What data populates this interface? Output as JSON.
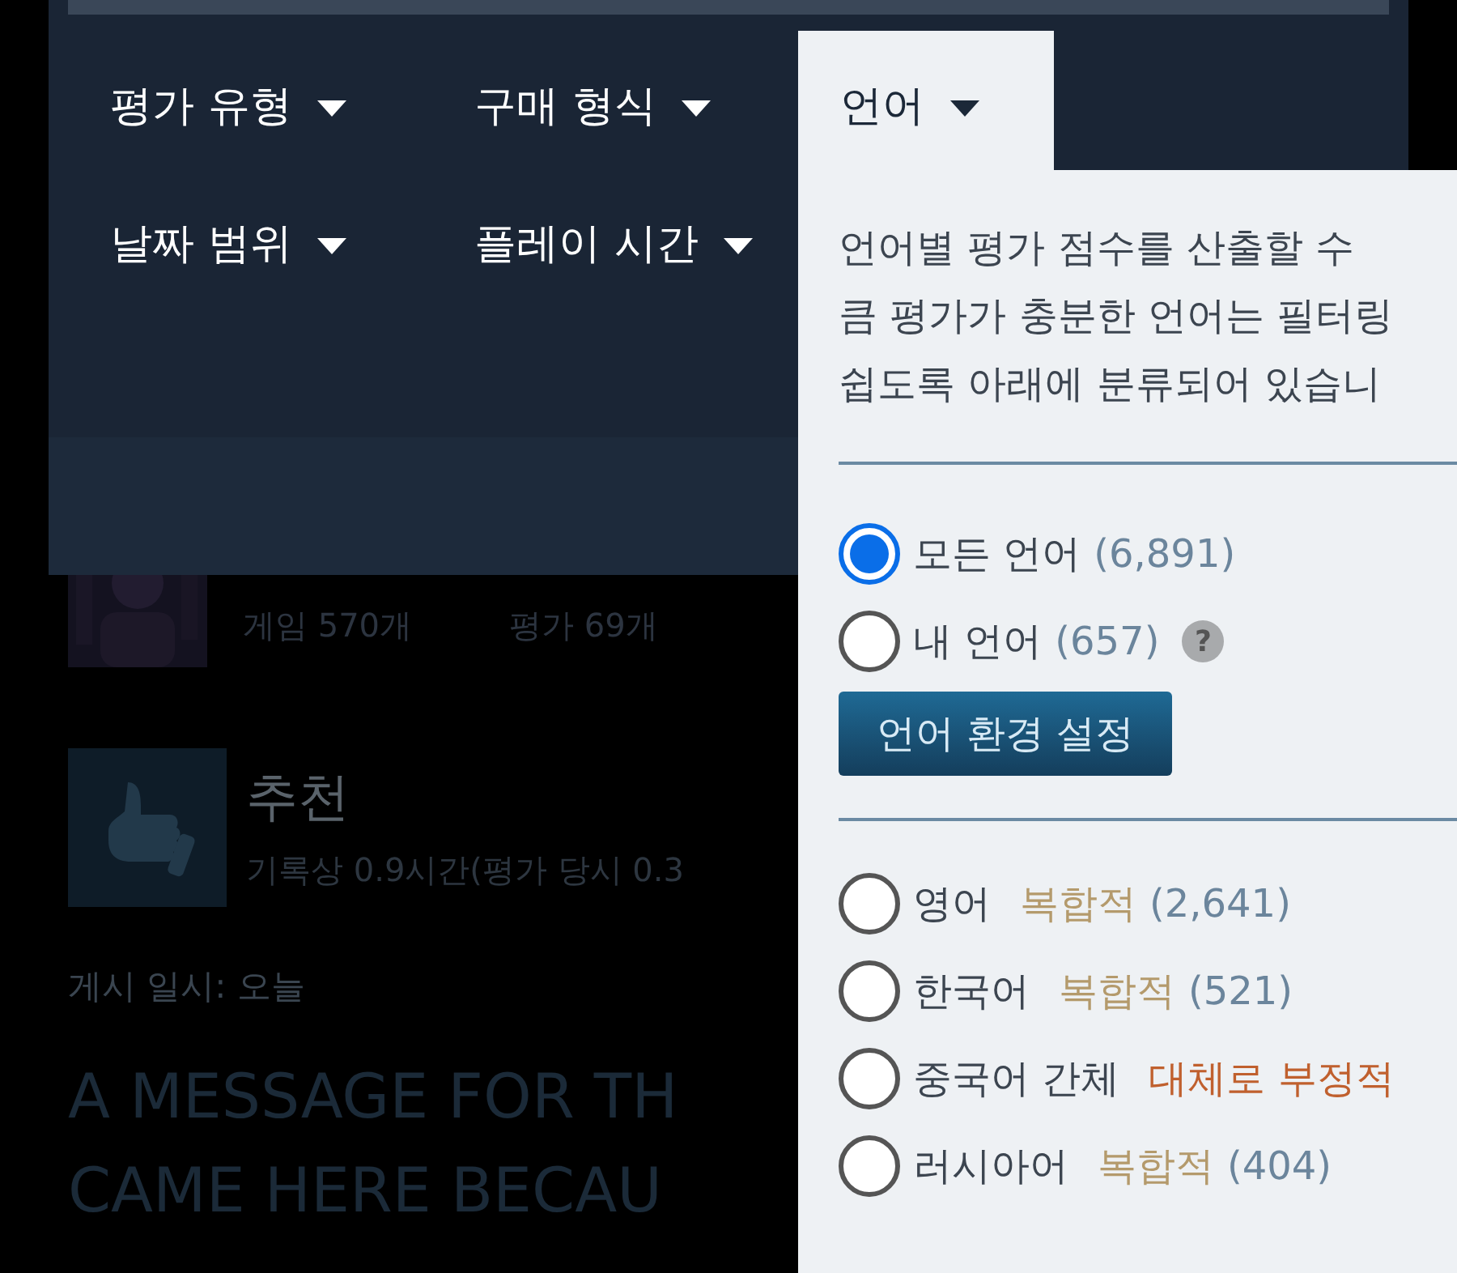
{
  "background_review": {
    "games_count": "게임 570개",
    "reviews_count": "평가 69개",
    "verdict": "추천",
    "playtime": "기록상 0.9시간(평가 당시 0.3",
    "posted": "게시 일시: 오늘",
    "title_lines": [
      "A MESSAGE FOR TH",
      "CAME HERE BECAU"
    ]
  },
  "filter_tabs": [
    {
      "label": "평가 유형",
      "selected": false
    },
    {
      "label": "구매 형식",
      "selected": false
    },
    {
      "label": "언어",
      "selected": true
    },
    {
      "label": "날짜 범위",
      "selected": false
    },
    {
      "label": "플레이 시간",
      "selected": false
    }
  ],
  "language_dropdown": {
    "description_lines": [
      "언어별 평가 점수를 산출할 수",
      "큼 평가가 충분한 언어는 필터링",
      "쉽도록 아래에 분류되어 있습니"
    ],
    "scope_options": [
      {
        "label": "모든 언어",
        "count": "(6,891)",
        "selected": true
      },
      {
        "label": "내 언어",
        "count": "(657)",
        "selected": false,
        "help": "?"
      }
    ],
    "settings_button": "언어 환경 설정",
    "languages": [
      {
        "name": "영어",
        "rating": "복합적",
        "color": "#b49a6c",
        "count": "(2,641)",
        "selected": false
      },
      {
        "name": "한국어",
        "rating": "복합적",
        "color": "#b49a6c",
        "count": "(521)",
        "selected": false
      },
      {
        "name": "중국어 간체",
        "rating": "대체로 부정적",
        "color": "#c0602e",
        "selected": false
      },
      {
        "name": "러시아어",
        "rating": "복합적",
        "color": "#b49a6c",
        "count": "(404)",
        "selected": false
      }
    ]
  }
}
